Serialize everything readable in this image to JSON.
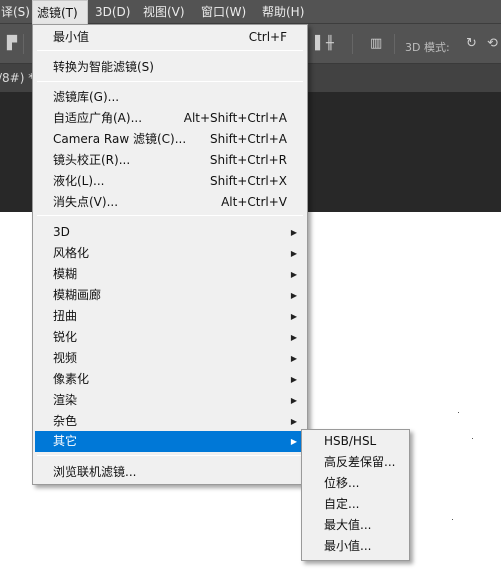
{
  "menubar": {
    "items": [
      {
        "label": "译(S)"
      },
      {
        "label": "滤镜(T)"
      },
      {
        "label": "3D(D)"
      },
      {
        "label": "视图(V)"
      },
      {
        "label": "窗口(W)"
      },
      {
        "label": "帮助(H)"
      }
    ]
  },
  "document_tab": {
    "title": "/8#) *"
  },
  "options_bar": {
    "mode_label": "3D 模式:"
  },
  "filter_menu": {
    "items": [
      {
        "label": "最小值",
        "shortcut": "Ctrl+F"
      },
      {
        "label": "转换为智能滤镜(S)",
        "shortcut": ""
      },
      {
        "label": "滤镜库(G)...",
        "shortcut": ""
      },
      {
        "label": "自适应广角(A)...",
        "shortcut": "Alt+Shift+Ctrl+A"
      },
      {
        "label": "Camera Raw 滤镜(C)...",
        "shortcut": "Shift+Ctrl+A"
      },
      {
        "label": "镜头校正(R)...",
        "shortcut": "Shift+Ctrl+R"
      },
      {
        "label": "液化(L)...",
        "shortcut": "Shift+Ctrl+X"
      },
      {
        "label": "消失点(V)...",
        "shortcut": "Alt+Ctrl+V"
      },
      {
        "label": "3D",
        "shortcut": ""
      },
      {
        "label": "风格化",
        "shortcut": ""
      },
      {
        "label": "模糊",
        "shortcut": ""
      },
      {
        "label": "模糊画廊",
        "shortcut": ""
      },
      {
        "label": "扭曲",
        "shortcut": ""
      },
      {
        "label": "锐化",
        "shortcut": ""
      },
      {
        "label": "视频",
        "shortcut": ""
      },
      {
        "label": "像素化",
        "shortcut": ""
      },
      {
        "label": "渲染",
        "shortcut": ""
      },
      {
        "label": "杂色",
        "shortcut": ""
      },
      {
        "label": "其它",
        "shortcut": ""
      },
      {
        "label": "浏览联机滤镜...",
        "shortcut": ""
      }
    ]
  },
  "other_submenu": {
    "items": [
      {
        "label": "HSB/HSL"
      },
      {
        "label": "高反差保留..."
      },
      {
        "label": "位移..."
      },
      {
        "label": "自定..."
      },
      {
        "label": "最大值..."
      },
      {
        "label": "最小值..."
      }
    ]
  },
  "colors": {
    "highlight": "#0078d7",
    "menu_bg": "#f0f0f0",
    "app_bg": "#535353"
  },
  "icons": [
    "align-top-icon",
    "3d-move-icon",
    "3d-align-icon",
    "distribute-icon",
    "3d-orbit-icon",
    "3d-roll-icon"
  ]
}
